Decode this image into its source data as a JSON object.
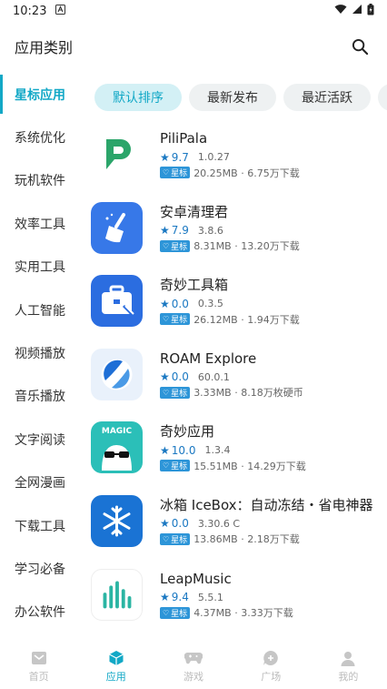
{
  "status_bar": {
    "time": "10:23"
  },
  "header": {
    "title": "应用类别"
  },
  "sidebar": {
    "items": [
      {
        "label": "星标应用",
        "active": true
      },
      {
        "label": "系统优化"
      },
      {
        "label": "玩机软件"
      },
      {
        "label": "效率工具"
      },
      {
        "label": "实用工具"
      },
      {
        "label": "人工智能"
      },
      {
        "label": "视频播放"
      },
      {
        "label": "音乐播放"
      },
      {
        "label": "文字阅读"
      },
      {
        "label": "全网漫画"
      },
      {
        "label": "下载工具"
      },
      {
        "label": "学习必备"
      },
      {
        "label": "办公软件"
      }
    ]
  },
  "chips": [
    {
      "label": "默认排序",
      "active": true
    },
    {
      "label": "最新发布"
    },
    {
      "label": "最近活跃"
    },
    {
      "label": "最"
    }
  ],
  "apps": [
    {
      "name": "PiliPala",
      "rating": "9.7",
      "version": "1.0.27",
      "badge": "星标",
      "stats": "20.25MB · 6.75万下载",
      "icon": "pilipala-icon"
    },
    {
      "name": "安卓清理君",
      "rating": "7.9",
      "version": "3.8.6",
      "badge": "星标",
      "stats": "8.31MB · 13.20万下载",
      "icon": "broom-icon"
    },
    {
      "name": "奇妙工具箱",
      "rating": "0.0",
      "version": "0.3.5",
      "badge": "星标",
      "stats": "26.12MB · 1.94万下载",
      "icon": "toolbox-icon"
    },
    {
      "name": "ROAM Explore",
      "rating": "0.0",
      "version": "60.0.1",
      "badge": "星标",
      "stats": "3.33MB · 8.18万枚硬币",
      "icon": "roam-icon"
    },
    {
      "name": "奇妙应用",
      "rating": "10.0",
      "version": "1.3.4",
      "badge": "星标",
      "stats": "15.51MB · 14.29万下载",
      "icon": "magic-robot-icon",
      "icon_text": "MAGIC"
    },
    {
      "name": "冰箱 IceBox：自动冻结・省电神器",
      "rating": "0.0",
      "version": "3.30.6 C",
      "badge": "星标",
      "stats": "13.86MB · 2.18万下载",
      "icon": "snowflake-icon"
    },
    {
      "name": "LeapMusic",
      "rating": "9.4",
      "version": "5.5.1",
      "badge": "星标",
      "stats": "4.37MB · 3.33万下载",
      "icon": "music-bars-icon"
    }
  ],
  "bottom_nav": [
    {
      "label": "首页",
      "icon": "home-icon"
    },
    {
      "label": "应用",
      "icon": "cube-icon",
      "active": true
    },
    {
      "label": "游戏",
      "icon": "gamepad-icon"
    },
    {
      "label": "广场",
      "icon": "chat-plus-icon"
    },
    {
      "label": "我的",
      "icon": "person-icon"
    }
  ],
  "colors": {
    "accent": "#12a8c6",
    "rating_blue": "#1a78c2",
    "badge_blue": "#2d95d8"
  }
}
